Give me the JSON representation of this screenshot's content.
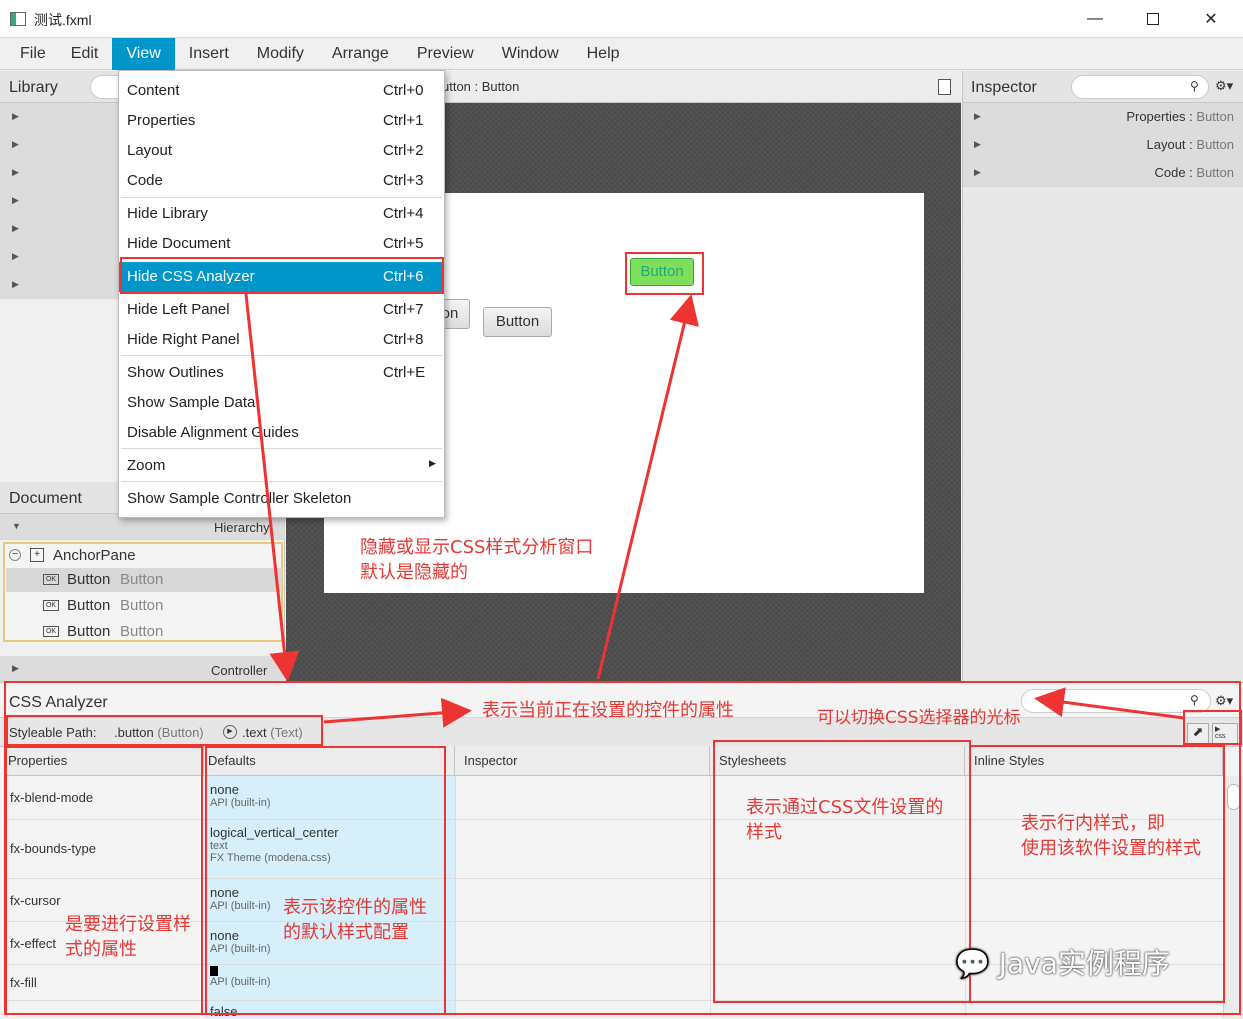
{
  "window": {
    "title": "测试.fxml"
  },
  "menubar": {
    "items": [
      "File",
      "Edit",
      "View",
      "Insert",
      "Modify",
      "Arrange",
      "Preview",
      "Window",
      "Help"
    ]
  },
  "view_menu": {
    "items": [
      {
        "label": "Content",
        "shortcut": "Ctrl+0"
      },
      {
        "label": "Properties",
        "shortcut": "Ctrl+1"
      },
      {
        "label": "Layout",
        "shortcut": "Ctrl+2"
      },
      {
        "label": "Code",
        "shortcut": "Ctrl+3"
      },
      {
        "label": "Hide Library",
        "shortcut": "Ctrl+4"
      },
      {
        "label": "Hide Document",
        "shortcut": "Ctrl+5"
      },
      {
        "label": "Hide CSS Analyzer",
        "shortcut": "Ctrl+6"
      },
      {
        "label": "Hide Left Panel",
        "shortcut": "Ctrl+7"
      },
      {
        "label": "Hide Right Panel",
        "shortcut": "Ctrl+8"
      },
      {
        "label": "Show Outlines",
        "shortcut": "Ctrl+E"
      },
      {
        "label": "Show Sample Data",
        "shortcut": ""
      },
      {
        "label": "Disable Alignment Guides",
        "shortcut": ""
      },
      {
        "label": "Zoom",
        "shortcut": ""
      },
      {
        "label": "Show Sample Controller Skeleton",
        "shortcut": ""
      }
    ]
  },
  "library": {
    "title": "Library"
  },
  "document": {
    "title": "Document",
    "hierarchy_label": "Hierarchy",
    "root": "AnchorPane",
    "nodes": [
      {
        "name": "Button",
        "type": "Button"
      },
      {
        "name": "Button",
        "type": "Button"
      },
      {
        "name": "Button",
        "type": "Button"
      }
    ],
    "controller_label": "Controller"
  },
  "content": {
    "breadcrumb": "utton : Button",
    "buttons": [
      "Button",
      "on",
      "Button"
    ]
  },
  "inspector": {
    "title": "Inspector",
    "sections": [
      {
        "name": "Properties",
        "target": "Button"
      },
      {
        "name": "Layout",
        "target": "Button"
      },
      {
        "name": "Code",
        "target": "Button"
      }
    ]
  },
  "css_analyzer": {
    "title": "CSS Analyzer",
    "styleable_path_label": "Styleable Path:",
    "path_1": ".button",
    "path_1_type": "(Button)",
    "path_2": ".text",
    "path_2_type": "(Text)",
    "columns": [
      "Properties",
      "Defaults",
      "Inspector",
      "Stylesheets",
      "Inline Styles"
    ],
    "rows": [
      {
        "property": "fx-blend-mode",
        "default": "none",
        "source": "API (built-in)"
      },
      {
        "property": "fx-bounds-type",
        "default": "logical_vertical_center",
        "default2": "text",
        "source": "FX Theme (modena.css)"
      },
      {
        "property": "fx-cursor",
        "default": "none",
        "source": "API (built-in)"
      },
      {
        "property": "fx-effect",
        "default": "none",
        "source": "API (built-in)"
      },
      {
        "property": "fx-fill",
        "default": "",
        "source": "API (built-in)"
      },
      {
        "property": "",
        "default": "false",
        "source": ""
      }
    ]
  },
  "annotations": {
    "hide_css": "隐藏或显示CSS样式分析窗口",
    "hide_css_2": "默认是隐藏的",
    "current_props": "表示当前正在设置的控件的属性",
    "cursor_switch": "可以切换CSS选择器的光标",
    "stylesheets": "表示通过CSS文件设置的",
    "stylesheets_2": "样式",
    "inline": "表示行内样式，即",
    "inline_2": "使用该软件设置的样式",
    "props": "是要进行设置样",
    "props_2": "式的属性",
    "defaults": "表示该控件的属性",
    "defaults_2": "的默认样式配置",
    "watermark": "Java实例程序"
  },
  "colors": {
    "accent": "#0096c9",
    "annotation": "#e53935",
    "highlight_cell": "#d6effa"
  }
}
